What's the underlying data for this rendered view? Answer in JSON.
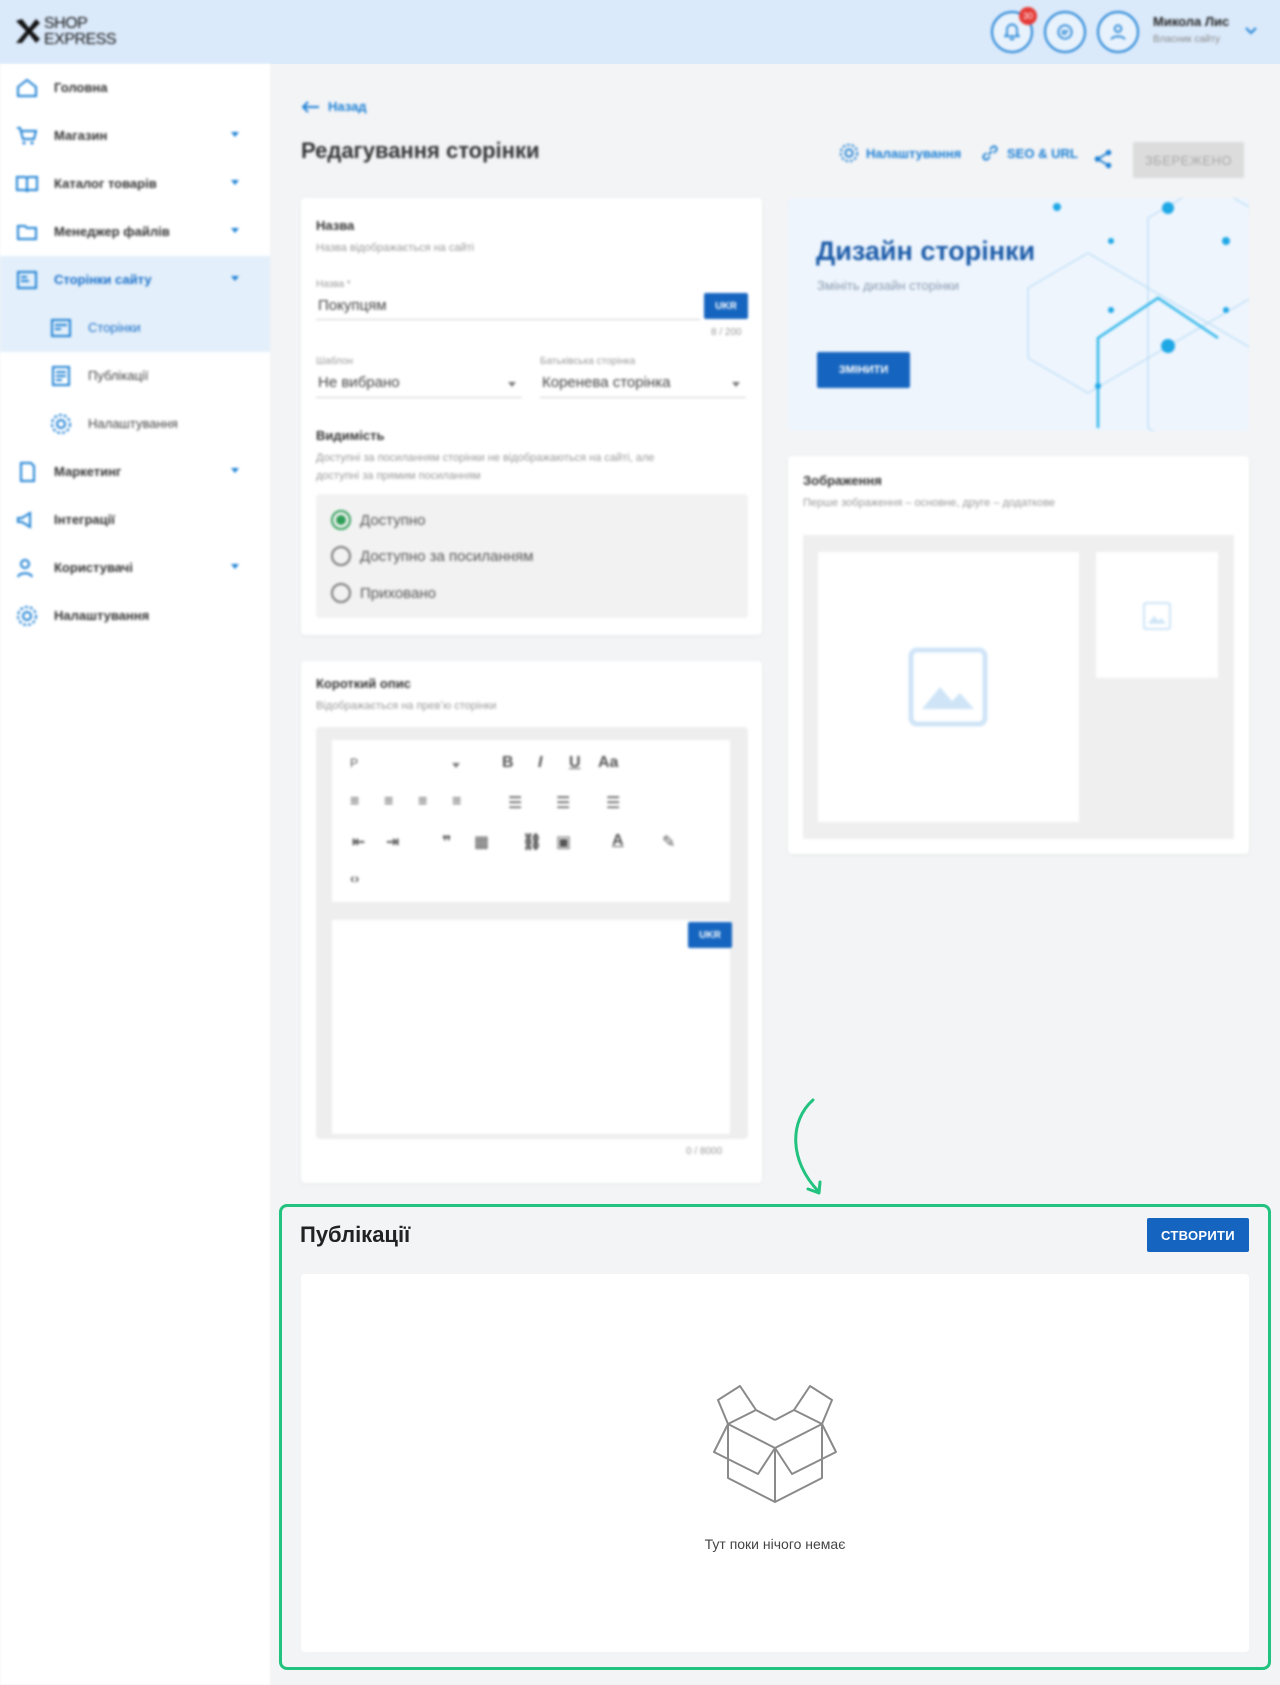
{
  "header": {
    "logo_line1": "SHOP",
    "logo_line2": "EXPRESS",
    "notifications_count": "30",
    "user_name": "Микола Лис",
    "user_role": "Власник сайту"
  },
  "sidebar": {
    "items": [
      {
        "label": "Головна",
        "icon": "home-icon"
      },
      {
        "label": "Магазин",
        "icon": "cart-icon"
      },
      {
        "label": "Каталог товарів",
        "icon": "book-icon"
      },
      {
        "label": "Менеджер файлів",
        "icon": "folder-icon"
      },
      {
        "label": "Сторінки сайту",
        "icon": "pages-icon"
      },
      {
        "label": "Сторінки",
        "icon": "page-icon"
      },
      {
        "label": "Публікації",
        "icon": "publication-icon"
      },
      {
        "label": "Налаштування",
        "icon": "gear-icon"
      },
      {
        "label": "Маркетинг",
        "icon": "marketing-icon"
      },
      {
        "label": "Інтеграції",
        "icon": "megaphone-icon"
      },
      {
        "label": "Користувачі",
        "icon": "users-icon"
      },
      {
        "label": "Налаштування",
        "icon": "gear-icon"
      }
    ]
  },
  "main": {
    "back_label": "Назад",
    "title": "Редагування сторінки",
    "toolbar": {
      "settings_label": "Налаштування",
      "seo_label": "SEO & URL",
      "save_label": "ЗБЕРЕЖЕНО"
    }
  },
  "name_card": {
    "title": "Назва",
    "subtitle": "Назва відображається на сайті",
    "field_label": "Назва *",
    "field_value": "Покупцям",
    "lang": "UKR",
    "counter": "8 / 200",
    "template_label": "Шаблон",
    "template_value": "Не вибрано",
    "parent_label": "Батьківська сторінка",
    "parent_value": "Коренева сторінка",
    "visibility_title": "Видимість",
    "visibility_sub1": "Доступні за посиланням сторінки не відображаються на сайті, але",
    "visibility_sub2": "доступні за прямим посиланням",
    "radio1": "Доступно",
    "radio2": "Доступно за посиланням",
    "radio3": "Приховано"
  },
  "desc_card": {
    "title": "Короткий опис",
    "subtitle": "Відображається на превʼю сторінки",
    "format_value": "P",
    "lang": "UKR",
    "counter": "0 / 8000"
  },
  "design_card": {
    "title": "Дизайн сторінки",
    "subtitle": "Змініть дизайн сторінки",
    "button": "ЗМІНИТИ"
  },
  "images_card": {
    "title": "Зображення",
    "subtitle": "Перше зображення – основне, друге – додаткове"
  },
  "publications": {
    "title": "Публікації",
    "create_label": "СТВОРИТИ",
    "empty_text": "Тут поки нічого немає"
  }
}
